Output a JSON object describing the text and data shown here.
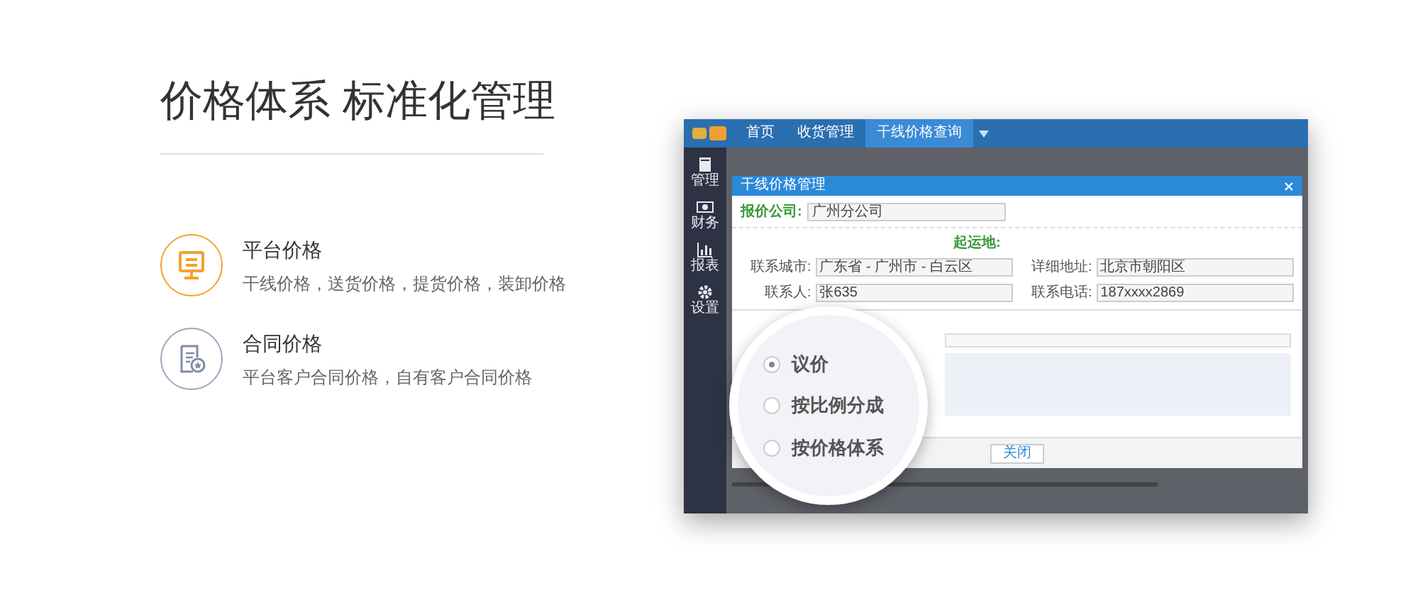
{
  "headline": "价格体系 标准化管理",
  "features": [
    {
      "kind": "monitor",
      "title": "平台价格",
      "description": "干线价格，送货价格，提货价格，装卸价格"
    },
    {
      "kind": "contract",
      "title": "合同价格",
      "description": "平台客户合同价格，自有客户合同价格"
    }
  ],
  "app_screenshot": {
    "nav_tabs": [
      {
        "label": "首页",
        "selected": false
      },
      {
        "label": "收货管理",
        "selected": false
      },
      {
        "label": "干线价格查询",
        "selected": true
      }
    ],
    "sidebar": [
      {
        "kind": "book",
        "label": "管理"
      },
      {
        "kind": "money",
        "label": "财务"
      },
      {
        "kind": "chart",
        "label": "报表"
      },
      {
        "kind": "gear",
        "label": "设置"
      }
    ],
    "dialog": {
      "title": "干线价格管理",
      "company_label": "报价公司:",
      "company_value": "广州分公司",
      "origin_label": "起运地:",
      "fields": [
        {
          "label": "联系城市:",
          "value": "广东省 - 广州市 - 白云区"
        },
        {
          "label": "详细地址:",
          "value": "北京市朝阳区"
        },
        {
          "label": "联系人:",
          "value": "张635"
        },
        {
          "label": "联系电话:",
          "value": "187xxxx2869"
        }
      ],
      "close_button": "关闭"
    },
    "magnifier": [
      {
        "label": "议价",
        "selected": true
      },
      {
        "label": "按比例分成",
        "selected": false
      },
      {
        "label": "按价格体系",
        "selected": false
      }
    ]
  }
}
